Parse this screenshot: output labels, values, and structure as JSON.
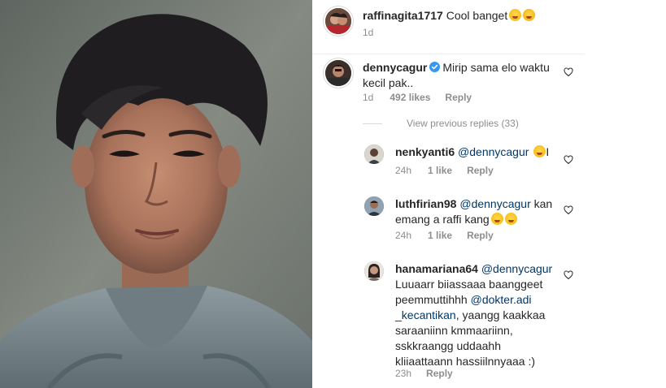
{
  "comments": [
    {
      "username": "raffinagita1717",
      "text": "Cool banget",
      "emojis": [
        "rolling-on-floor-laughing-emoji",
        "face-blowing-kiss-emoji"
      ],
      "time": "1d"
    },
    {
      "username": "dennycagur",
      "verified": true,
      "text_line1": "Mirip sama elo waktu",
      "text_line2": "kecil pak..",
      "time": "1d",
      "likes": "492 likes",
      "reply": "Reply"
    }
  ],
  "view_previous": "View previous replies (33)",
  "replies": [
    {
      "username": "nenkyanti6",
      "mention": "@dennycagur",
      "suffix": "I",
      "emojis": [
        "grinning-face-emoji"
      ],
      "time": "24h",
      "likes": "1 like",
      "reply": "Reply"
    },
    {
      "username": "luthfirian98",
      "mention": "@dennycagur",
      "text_after": "kan",
      "text_line2": "emang a raffi kang",
      "emojis": [
        "rolling-on-floor-laughing-emoji",
        "face-with-tears-of-joy-emoji"
      ],
      "time": "24h",
      "likes": "1 like",
      "reply": "Reply"
    },
    {
      "username": "hanamariana64",
      "mention": "@dennycagur",
      "line2": "Luuaarr biiassaaa baanggeet",
      "line3": "peemmuttihhh",
      "mention2_part1": "@dokter.adi",
      "mention2_part2": "_kecantikan",
      "line4_rest": ", yaangg kaakkaa",
      "line5": "saraaniinn kmmaariinn,",
      "line6": "sskkraangg uddaahh",
      "line7": "kliiaattaann hassiilnnyaaa :)",
      "time": "23h",
      "reply": "Reply"
    }
  ],
  "colors": {
    "text": "#262626",
    "muted": "#8e8e8e",
    "mention": "#00376b",
    "verified": "#3897f0"
  }
}
